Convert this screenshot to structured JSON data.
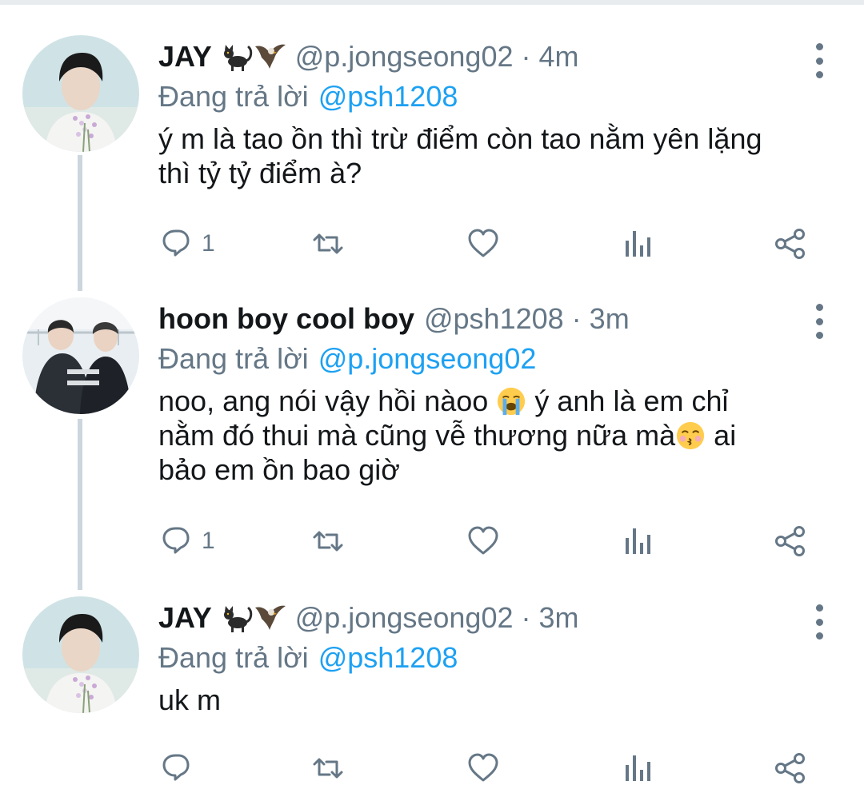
{
  "colors": {
    "text": "#14171a",
    "secondary": "#657786",
    "link": "#1da1f2",
    "thread_line": "#ccd6dd"
  },
  "tweets": [
    {
      "name": "JAY",
      "name_emojis": [
        "black-cat-emoji",
        "eagle-emoji"
      ],
      "handle": "@p.jongseong02",
      "separator": "·",
      "time": "4m",
      "reply_prefix": "Đang trả lời",
      "reply_to": "@psh1208",
      "text_lines": [
        "ý m là tao ồn thì trừ điểm còn tao nằm yên lặng",
        "thì tỷ tỷ điểm à?"
      ],
      "reply_count": "1",
      "avatar": "jay-avatar"
    },
    {
      "name": "hoon boy cool boy",
      "handle": "@psh1208",
      "separator": "·",
      "time": "3m",
      "reply_prefix": "Đang trả lời",
      "reply_to": "@p.jongseong02",
      "text_parts": {
        "line1_a": "noo, ang nói vậy hồi nàoo",
        "line1_b": "ý anh là em chỉ",
        "line2_a": "nằm đó thui mà cũng vễ thương nữa mà",
        "line2_b": "ai",
        "line3": "bảo em ồn bao giờ"
      },
      "emojis": [
        "loudly-crying-face-emoji",
        "kissing-face-emoji"
      ],
      "reply_count": "1",
      "avatar": "hoon-avatar"
    },
    {
      "name": "JAY",
      "name_emojis": [
        "black-cat-emoji",
        "eagle-emoji"
      ],
      "handle": "@p.jongseong02",
      "separator": "·",
      "time": "3m",
      "reply_prefix": "Đang trả lời",
      "reply_to": "@psh1208",
      "text_lines": [
        "uk m"
      ],
      "reply_count": "",
      "avatar": "jay-avatar"
    }
  ],
  "icons": {
    "reply": "reply-icon",
    "retweet": "retweet-icon",
    "like": "heart-icon",
    "analytics": "analytics-icon",
    "share": "share-icon",
    "more": "more-vertical-icon"
  }
}
